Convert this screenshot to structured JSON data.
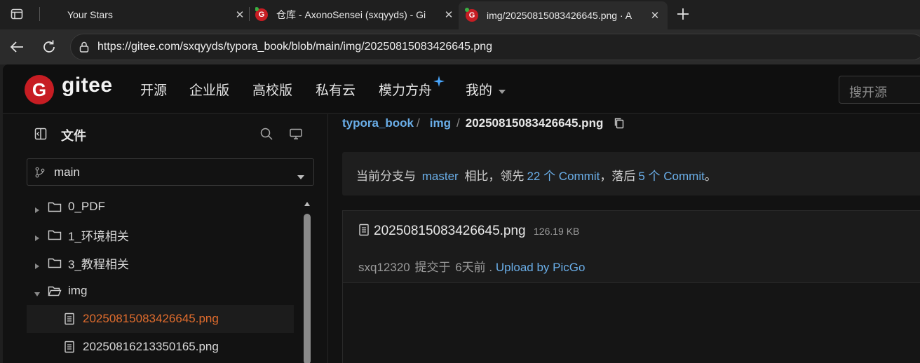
{
  "browser": {
    "tabs": [
      {
        "title": "Your Stars",
        "active": false
      },
      {
        "title": "仓库 - AxonoSensei (sxqyyds) - Gi",
        "active": false
      },
      {
        "title": "img/20250815083426645.png · A",
        "active": true
      }
    ],
    "url": "https://gitee.com/sxqyyds/typora_book/blob/main/img/20250815083426645.png"
  },
  "gitee": {
    "logo_text": "gitee",
    "logo_letter": "G",
    "nav": [
      "开源",
      "企业版",
      "高校版",
      "私有云",
      "模力方舟",
      "我的"
    ],
    "search_placeholder": "搜开源"
  },
  "sidebar": {
    "title": "文件",
    "branch": "main",
    "tree": [
      {
        "label": "0_PDF",
        "type": "folder",
        "expanded": false
      },
      {
        "label": "1_环境相关",
        "type": "folder",
        "expanded": false
      },
      {
        "label": "3_教程相关",
        "type": "folder",
        "expanded": false
      },
      {
        "label": "img",
        "type": "folder",
        "expanded": true
      },
      {
        "label": "20250815083426645.png",
        "type": "file",
        "selected": true
      },
      {
        "label": "20250816213350165.png",
        "type": "file",
        "selected": false
      }
    ]
  },
  "breadcrumb": {
    "repo": "typora_book",
    "dir": "img",
    "file": "20250815083426645.png",
    "sep1": "/",
    "sep2": "/"
  },
  "notice": {
    "prefix": "当前分支与",
    "branch": "master",
    "mid1": "相比，领先",
    "ahead": "22 个 Commit",
    "mid2": "，落后",
    "behind": "5 个 Commit",
    "suffix": "。"
  },
  "file": {
    "name": "20250815083426645.png",
    "size": "126.19 KB",
    "author": "sxq12320",
    "action": "提交于",
    "time": "6天前",
    "dot": ".",
    "message": "Upload by PicGo"
  },
  "colors": {
    "accent_link": "#6aaee8",
    "selected_file": "#e06c2d",
    "gitee_red": "#c71d23",
    "star_blue": "#4aa8ff"
  }
}
